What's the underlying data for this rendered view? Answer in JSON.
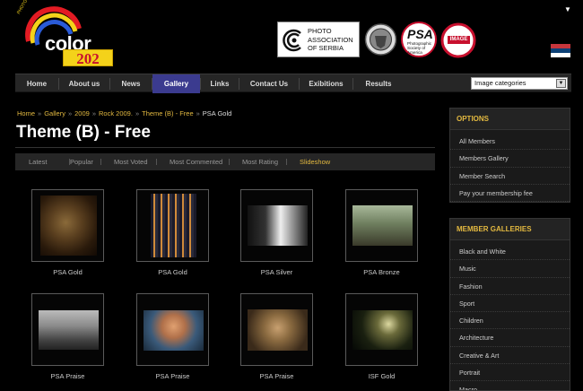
{
  "logo": {
    "word": "color",
    "number": "202",
    "tagline": "PHOTO CLUB"
  },
  "partners": {
    "association": [
      "PHOTO",
      "ASSOCIATION",
      "OF SERBIA"
    ],
    "psa": "PSA",
    "psa_sub": "Photographic Society of America",
    "image_badge": "IMAGE"
  },
  "nav": {
    "items": [
      "Home",
      "About us",
      "News",
      "Gallery",
      "Links",
      "Contact Us",
      "Exibitions",
      "Results"
    ],
    "active": "Gallery",
    "category_select": "Image categories"
  },
  "breadcrumb": [
    "Home",
    "Gallery",
    "2009",
    "Rock 2009.",
    "Theme (B) - Free",
    "PSA Gold"
  ],
  "page_title": "Theme (B) - Free",
  "sort_tabs": [
    "Latest",
    "Popular",
    "Most Voted",
    "Most Commented",
    "Most Rating",
    "Slideshow"
  ],
  "sort_active": "Slideshow",
  "gallery": {
    "items": [
      {
        "caption": "PSA Gold"
      },
      {
        "caption": "PSA Gold"
      },
      {
        "caption": "PSA Silver"
      },
      {
        "caption": "PSA Bronze"
      },
      {
        "caption": "PSA Praise"
      },
      {
        "caption": "PSA Praise"
      },
      {
        "caption": "PSA Praise"
      },
      {
        "caption": "ISF Gold"
      }
    ]
  },
  "sidebar": {
    "options_title": "OPTIONS",
    "options": [
      "All Members",
      "Members Gallery",
      "Member Search",
      "Pay your membership fee"
    ],
    "galleries_title": "MEMBER GALLERIES",
    "galleries": [
      "Black and White",
      "Music",
      "Fashion",
      "Sport",
      "Children",
      "Architecture",
      "Creative & Art",
      "Portrait",
      "Macro"
    ]
  },
  "colors": {
    "accent": "#e3b940",
    "nav_active": "#3b3b8f",
    "background": "#000000",
    "panel": "#1a1a1a"
  }
}
